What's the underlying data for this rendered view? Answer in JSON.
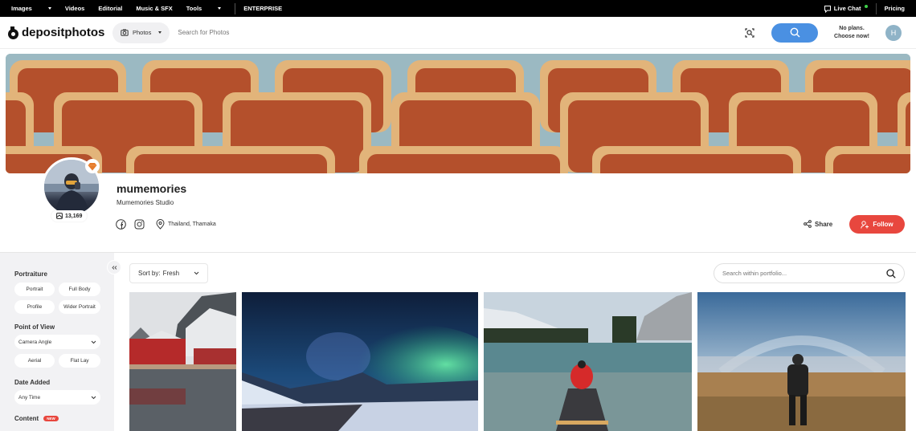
{
  "topnav": {
    "items": [
      {
        "label": "Images",
        "has_dropdown": true
      },
      {
        "label": "Videos",
        "has_dropdown": false
      },
      {
        "label": "Editorial",
        "has_dropdown": false
      },
      {
        "label": "Music & SFX",
        "has_dropdown": false
      },
      {
        "label": "Tools",
        "has_dropdown": true
      }
    ],
    "enterprise": "ENTERPRISE",
    "live_chat": "Live Chat",
    "pricing": "Pricing"
  },
  "header": {
    "logo_text": "depositphotos",
    "search_type": "Photos",
    "search_placeholder": "Search for Photos",
    "plans_line1": "No plans.",
    "plans_line2": "Choose now!",
    "avatar_initial": "H",
    "accent_color": "#4a90e2"
  },
  "profile": {
    "username": "mumemories",
    "studio": "Mumemories Studio",
    "file_count": "13,169",
    "location": "Thailand, Thamaka",
    "share_label": "Share",
    "follow_label": "Follow",
    "follow_color": "#e8473e"
  },
  "sidebar": {
    "collapse_icon": "double-chevron-left",
    "portraiture": {
      "heading": "Portraiture",
      "chips": [
        "Portrait",
        "Full Body",
        "Profile",
        "Wider Portrait"
      ]
    },
    "point_of_view": {
      "heading": "Point of View",
      "select_value": "Camera Angle",
      "chips": [
        "Aerial",
        "Flat Lay"
      ]
    },
    "date_added": {
      "heading": "Date Added",
      "select_value": "Any Time"
    },
    "content": {
      "heading": "Content",
      "badge": "NEW"
    }
  },
  "gallery": {
    "sort_label": "Sort by:",
    "sort_value": "Fresh",
    "search_placeholder": "Search within portfolio...",
    "photos": [
      {
        "subject": "red-fishing-cabins-snowy-mountain"
      },
      {
        "subject": "aurora-borealis-over-snowy-mountains"
      },
      {
        "subject": "person-in-red-jacket-canoeing-mountain-lake"
      },
      {
        "subject": "hiker-with-backpack-fogbow-meadow"
      }
    ]
  }
}
